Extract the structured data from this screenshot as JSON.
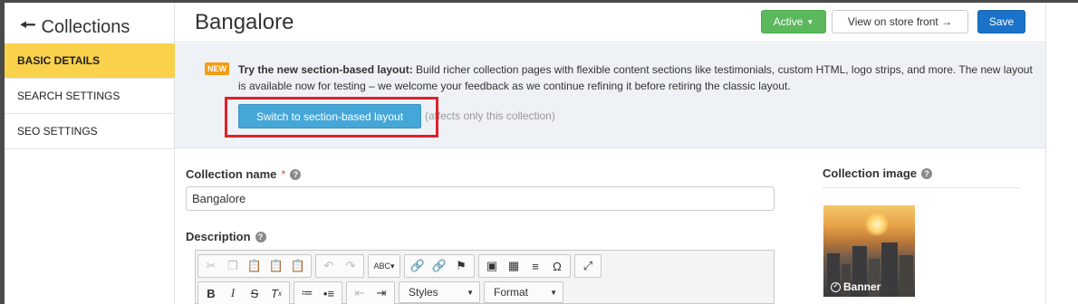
{
  "sidebar": {
    "back_label": "Collections",
    "items": [
      {
        "label": "BASIC DETAILS"
      },
      {
        "label": "SEARCH SETTINGS"
      },
      {
        "label": "SEO SETTINGS"
      }
    ]
  },
  "header": {
    "title": "Bangalore",
    "status_label": "Active",
    "store_label": "View on store front →",
    "save_label": "Save"
  },
  "banner": {
    "badge": "NEW",
    "headline": "Try the new section-based layout:",
    "body": " Build richer collection pages with flexible content sections like testimonials, custom HTML, logo strips, and more. The new layout is available now for testing – we welcome your feedback as we continue refining it before retiring the classic layout.",
    "switch_label": "Switch to section-based layout",
    "switch_note": "(affects only this collection)"
  },
  "form": {
    "name_label": "Collection name",
    "name_required": "*",
    "name_value": "Bangalore",
    "description_label": "Description",
    "styles_label": "Styles",
    "format_label": "Format",
    "image_label": "Collection image",
    "image_caption": "Banner"
  },
  "colors": {
    "active_nav": "#f9d14a",
    "active_button": "#5cb85c",
    "save_button": "#1a73c9",
    "switch_button": "#45a7d8",
    "highlight": "#e0202a"
  }
}
